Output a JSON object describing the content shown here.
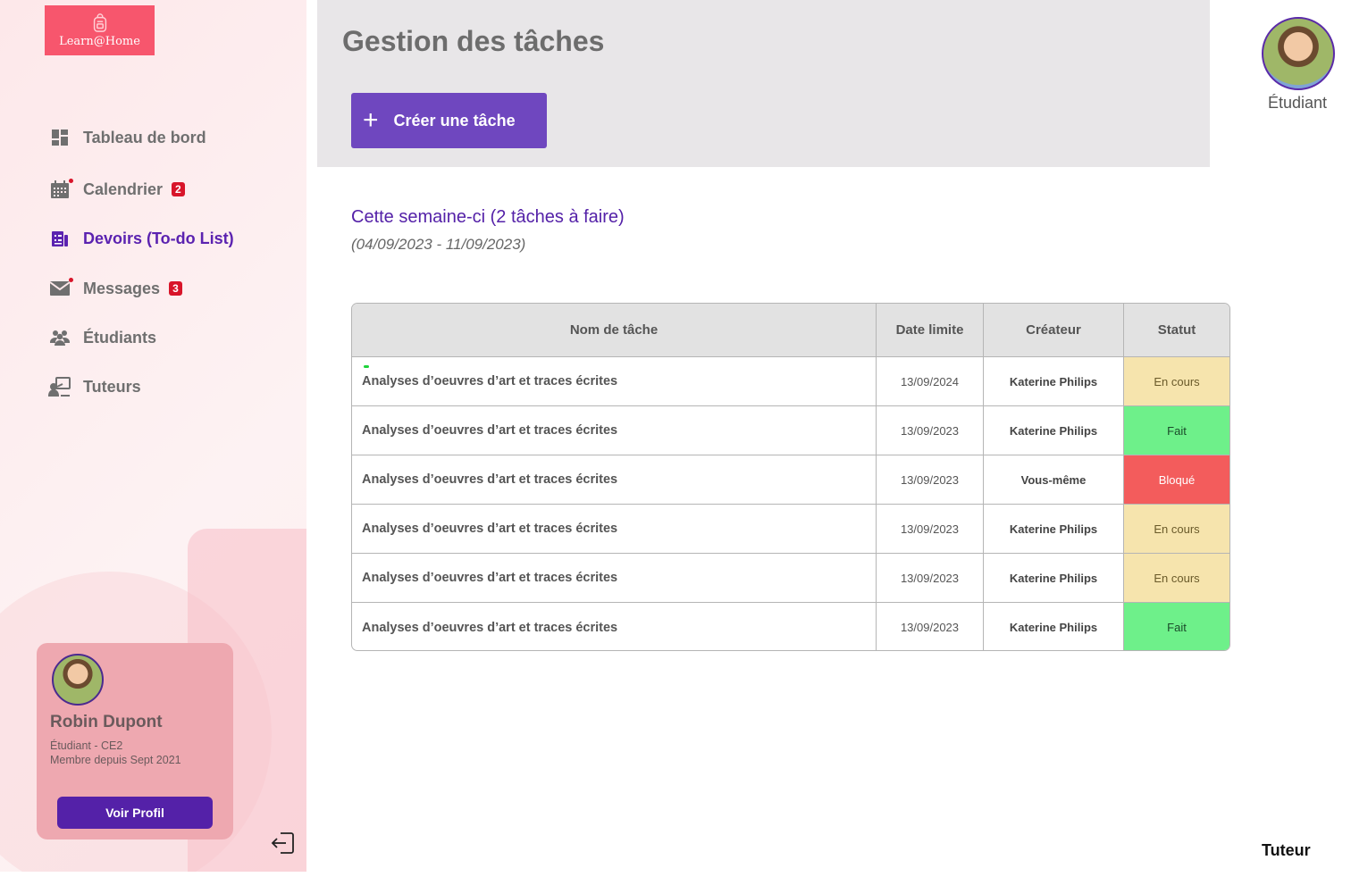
{
  "app": {
    "logo_text": "Learn@Home"
  },
  "sidebar": {
    "items": [
      {
        "label": "Tableau de bord",
        "icon": "dashboard-icon",
        "badge": null,
        "active": false
      },
      {
        "label": "Calendrier",
        "icon": "calendar-icon",
        "badge": "2",
        "active": false
      },
      {
        "label": "Devoirs (To-do List)",
        "icon": "assignment-icon",
        "badge": null,
        "active": true
      },
      {
        "label": "Messages",
        "icon": "mail-icon",
        "badge": "3",
        "active": false
      },
      {
        "label": "Étudiants",
        "icon": "students-icon",
        "badge": null,
        "active": false
      },
      {
        "label": "Tuteurs",
        "icon": "tutor-icon",
        "badge": null,
        "active": false
      }
    ]
  },
  "profile": {
    "name": "Robin Dupont",
    "class_line": "Étudiant - CE2",
    "member_line": "Membre depuis Sept 2021",
    "button_label": "Voir Profil"
  },
  "header": {
    "title": "Gestion des tâches",
    "create_button": "Créer une tâche"
  },
  "user": {
    "role": "Étudiant",
    "footer_role": "Tuteur"
  },
  "week": {
    "title": "Cette semaine-ci (2 tâches à faire)",
    "range": "(04/09/2023 - 11/09/2023)"
  },
  "table": {
    "columns": [
      "Nom de tâche",
      "Date limite",
      "Créateur",
      "Statut"
    ],
    "rows": [
      {
        "name": "Analyses d’oeuvres d’art et traces écrites",
        "date": "13/09/2024",
        "creator": "Katerine Philips",
        "status": "En cours"
      },
      {
        "name": "Analyses d’oeuvres d’art et traces écrites",
        "date": "13/09/2023",
        "creator": "Katerine Philips",
        "status": "Fait"
      },
      {
        "name": "Analyses d’oeuvres d’art et traces écrites",
        "date": "13/09/2023",
        "creator": "Vous-même",
        "status": "Bloqué"
      },
      {
        "name": "Analyses d’oeuvres d’art et traces écrites",
        "date": "13/09/2023",
        "creator": "Katerine Philips",
        "status": "En cours"
      },
      {
        "name": "Analyses d’oeuvres d’art et traces écrites",
        "date": "13/09/2023",
        "creator": "Katerine Philips",
        "status": "En cours"
      },
      {
        "name": "Analyses d’oeuvres d’art et traces écrites",
        "date": "13/09/2023",
        "creator": "Katerine Philips",
        "status": "Fait"
      }
    ]
  },
  "colors": {
    "accent": "#5421a8",
    "logo_bg": "#f7566d",
    "status_in_progress": "#f6e4ad",
    "status_done": "#6ef08a",
    "status_blocked": "#f35c5c"
  }
}
